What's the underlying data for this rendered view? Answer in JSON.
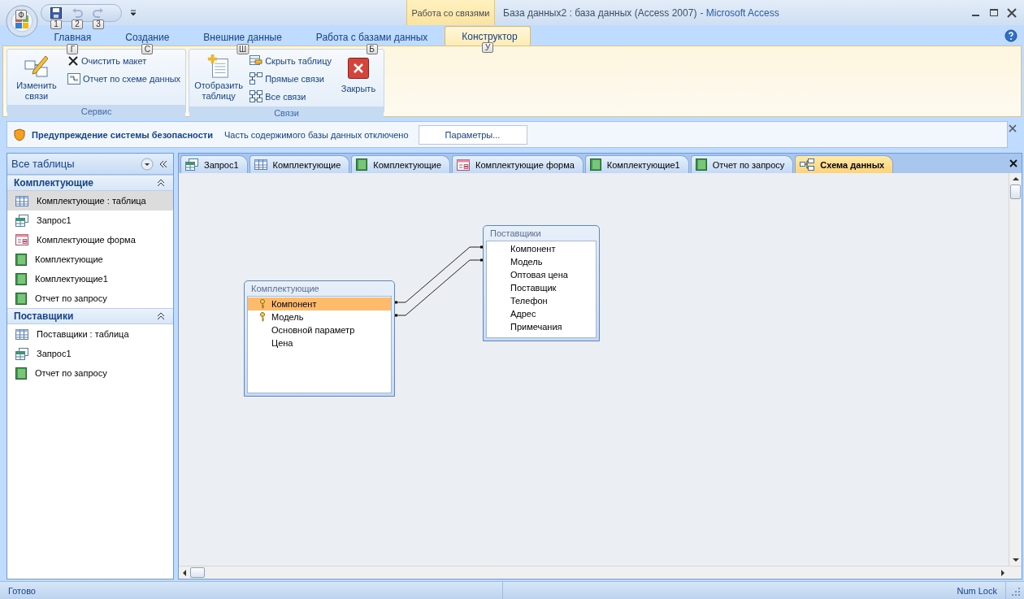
{
  "window": {
    "document_title": "База данных2 : база данных (Access 2007)",
    "app_title": "- Microsoft Access",
    "office_keytip": "Ф"
  },
  "quick_access": [
    {
      "keytip": "1",
      "disabled": false
    },
    {
      "keytip": "2",
      "disabled": true
    },
    {
      "keytip": "3",
      "disabled": true
    }
  ],
  "context_group": "Работа со связями",
  "ribbon_tabs": [
    {
      "label": "Главная",
      "keytip": "Г",
      "selected": false,
      "contextual": false
    },
    {
      "label": "Создание",
      "keytip": "С",
      "selected": false,
      "contextual": false
    },
    {
      "label": "Внешние данные",
      "keytip": "Ш",
      "selected": false,
      "contextual": false
    },
    {
      "label": "Работа с базами данных",
      "keytip": "Б",
      "selected": false,
      "contextual": false
    },
    {
      "label": "Конструктор",
      "keytip": "У",
      "selected": true,
      "contextual": true
    }
  ],
  "ribbon_groups": [
    {
      "label": "Сервис",
      "large": [
        {
          "label": "Изменить связи"
        }
      ],
      "small": [
        {
          "label": "Очистить макет"
        },
        {
          "label": "Отчет по схеме данных"
        }
      ]
    },
    {
      "label": "Связи",
      "large": [
        {
          "label": "Отобразить таблицу"
        }
      ],
      "small": [
        {
          "label": "Скрыть таблицу"
        },
        {
          "label": "Прямые связи"
        },
        {
          "label": "Все связи"
        }
      ],
      "trailing": [
        {
          "label": "Закрыть"
        }
      ]
    }
  ],
  "security_bar": {
    "title": "Предупреждение системы безопасности",
    "message": "Часть содержимого базы данных отключено",
    "button": "Параметры..."
  },
  "nav_pane": {
    "title": "Все таблицы",
    "groups": [
      {
        "title": "Комплектующие",
        "expanded": true,
        "items": [
          {
            "label": "Комплектующие : таблица",
            "kind": "table",
            "selected": true
          },
          {
            "label": "Запрос1",
            "kind": "query",
            "selected": false
          },
          {
            "label": "Комплектующие форма",
            "kind": "form",
            "selected": false
          },
          {
            "label": "Комплектующие",
            "kind": "report",
            "selected": false
          },
          {
            "label": "Комплектующие1",
            "kind": "report",
            "selected": false
          },
          {
            "label": "Отчет по запросу",
            "kind": "report",
            "selected": false
          }
        ]
      },
      {
        "title": "Поставщики",
        "expanded": true,
        "items": [
          {
            "label": "Поставщики : таблица",
            "kind": "table",
            "selected": false
          },
          {
            "label": "Запрос1",
            "kind": "query",
            "selected": false
          },
          {
            "label": "Отчет по запросу",
            "kind": "report",
            "selected": false
          }
        ]
      }
    ]
  },
  "doc_tabs": [
    {
      "label": "Запрос1",
      "kind": "query",
      "selected": false
    },
    {
      "label": "Комплектующие",
      "kind": "table",
      "selected": false
    },
    {
      "label": "Комплектующие",
      "kind": "report",
      "selected": false
    },
    {
      "label": "Комплектующие форма",
      "kind": "form",
      "selected": false
    },
    {
      "label": "Комплектующие1",
      "kind": "report",
      "selected": false
    },
    {
      "label": "Отчет по запросу",
      "kind": "report",
      "selected": false
    },
    {
      "label": "Схема данных",
      "kind": "relations",
      "selected": true
    }
  ],
  "diagram": {
    "tables": [
      {
        "title": "Комплектующие",
        "fields": [
          {
            "name": "Компонент",
            "primary_key": true,
            "selected": true
          },
          {
            "name": "Модель",
            "primary_key": true,
            "selected": false
          },
          {
            "name": "Основной параметр",
            "primary_key": false,
            "selected": false
          },
          {
            "name": "Цена",
            "primary_key": false,
            "selected": false
          }
        ]
      },
      {
        "title": "Поставщики",
        "fields": [
          {
            "name": "Компонент",
            "primary_key": false,
            "selected": false
          },
          {
            "name": "Модель",
            "primary_key": false,
            "selected": false
          },
          {
            "name": "Оптовая цена",
            "primary_key": false,
            "selected": false
          },
          {
            "name": "Поставщик",
            "primary_key": false,
            "selected": false
          },
          {
            "name": "Телефон",
            "primary_key": false,
            "selected": false
          },
          {
            "name": "Адрес",
            "primary_key": false,
            "selected": false
          },
          {
            "name": "Примечания",
            "primary_key": false,
            "selected": false
          }
        ]
      }
    ]
  },
  "status_bar": {
    "left": "Готово",
    "right": "Num Lock"
  }
}
